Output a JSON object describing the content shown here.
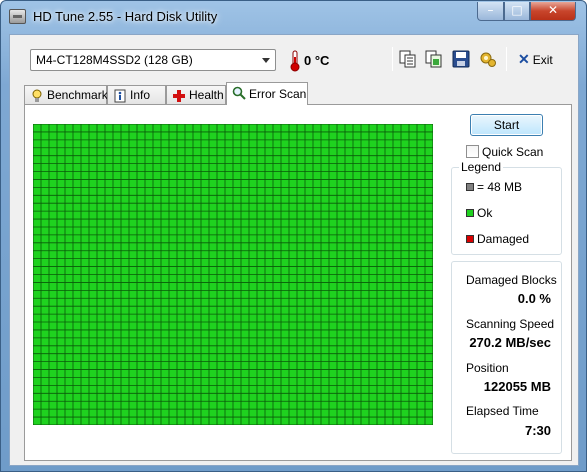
{
  "window": {
    "title": "HD Tune 2.55 - Hard Disk Utility",
    "controls": {
      "minimize": "–",
      "maximize": "□",
      "close": "✕"
    }
  },
  "toolbar": {
    "drive": "M4-CT128M4SSD2 (128 GB)",
    "temperature": "0 °C",
    "icons": [
      "copy-text-icon",
      "copy-image-icon",
      "save-icon",
      "options-icon"
    ],
    "exit_label": "Exit"
  },
  "tabs": [
    {
      "label": "Benchmark",
      "icon": "benchmark-icon",
      "active": false
    },
    {
      "label": "Info",
      "icon": "info-icon",
      "active": false
    },
    {
      "label": "Health",
      "icon": "health-icon",
      "active": false
    },
    {
      "label": "Error Scan",
      "icon": "magnifier-icon",
      "active": true
    }
  ],
  "scan": {
    "start_label": "Start",
    "quick_scan_label": "Quick Scan",
    "quick_scan_checked": false,
    "grid": {
      "columns": 50,
      "rows": 38,
      "ok_color": "#1fd21f",
      "line_color": "#0a5a0a"
    }
  },
  "legend": {
    "title": "Legend",
    "items": [
      {
        "label": "= 48 MB",
        "color": "#808080"
      },
      {
        "label": "Ok",
        "color": "#1fd21f"
      },
      {
        "label": "Damaged",
        "color": "#d80000"
      }
    ]
  },
  "stats": {
    "damaged_blocks_label": "Damaged Blocks",
    "damaged_blocks_value": "0.0 %",
    "scanning_speed_label": "Scanning Speed",
    "scanning_speed_value": "270.2 MB/sec",
    "position_label": "Position",
    "position_value": "122055 MB",
    "elapsed_time_label": "Elapsed Time",
    "elapsed_time_value": "7:30"
  }
}
